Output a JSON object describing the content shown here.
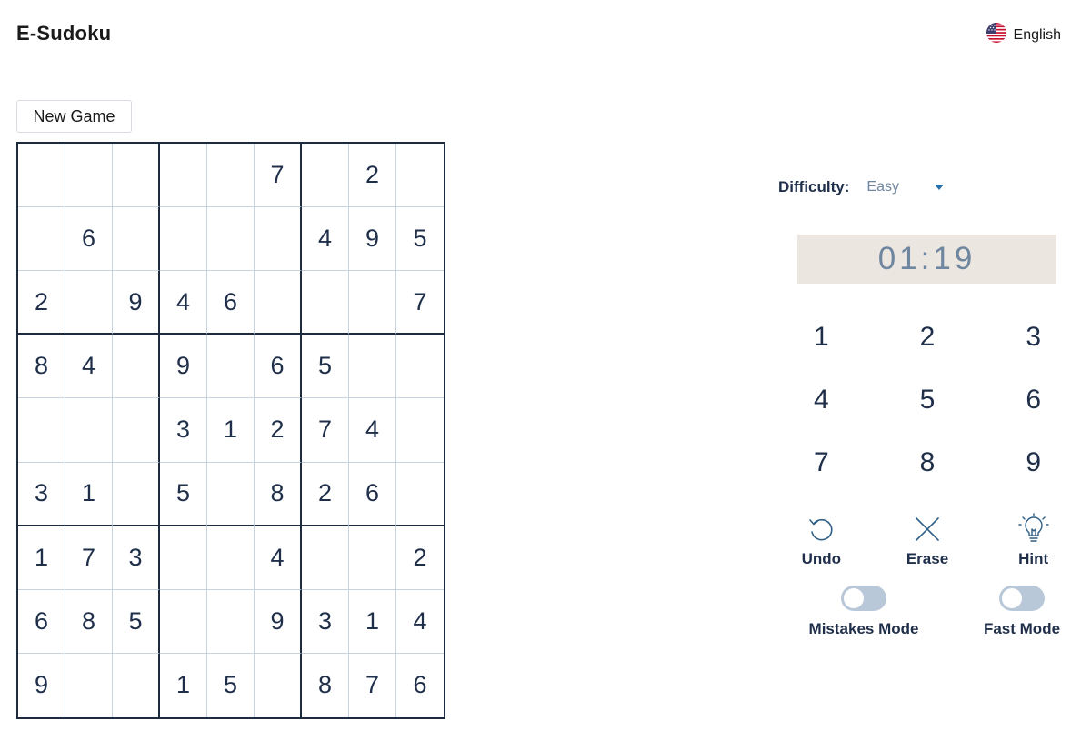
{
  "header": {
    "app_title": "E-Sudoku",
    "language": "English",
    "language_icon": "us-flag-icon"
  },
  "controls": {
    "new_game_label": "New Game"
  },
  "board": {
    "rows": [
      [
        "",
        "",
        "",
        "",
        "",
        "7",
        "",
        "2",
        ""
      ],
      [
        "",
        "6",
        "",
        "",
        "",
        "",
        "4",
        "9",
        "5"
      ],
      [
        "2",
        "",
        "9",
        "4",
        "6",
        "",
        "",
        "",
        "7"
      ],
      [
        "8",
        "4",
        "",
        "9",
        "",
        "6",
        "5",
        "",
        ""
      ],
      [
        "",
        "",
        "",
        "3",
        "1",
        "2",
        "7",
        "4",
        ""
      ],
      [
        "3",
        "1",
        "",
        "5",
        "",
        "8",
        "2",
        "6",
        ""
      ],
      [
        "1",
        "7",
        "3",
        "",
        "",
        "4",
        "",
        "",
        "2"
      ],
      [
        "6",
        "8",
        "5",
        "",
        "",
        "9",
        "3",
        "1",
        "4"
      ],
      [
        "9",
        "",
        "",
        "1",
        "5",
        "",
        "8",
        "7",
        "6"
      ]
    ]
  },
  "sidebar": {
    "difficulty_label": "Difficulty:",
    "difficulty_value": "Easy",
    "timer": "01:19",
    "numpad": [
      "1",
      "2",
      "3",
      "4",
      "5",
      "6",
      "7",
      "8",
      "9"
    ],
    "tools": [
      {
        "label": "Undo",
        "icon": "undo-icon"
      },
      {
        "label": "Erase",
        "icon": "erase-icon"
      },
      {
        "label": "Hint",
        "icon": "lightbulb-icon"
      }
    ],
    "modes": [
      {
        "label": "Mistakes Mode",
        "enabled": false
      },
      {
        "label": "Fast Mode",
        "enabled": false
      }
    ]
  },
  "colors": {
    "text_primary": "#1f2f4a",
    "grid_thin": "#c7d3df",
    "grid_thick": "#1e2b3f",
    "muted": "#6f86a0",
    "timer_bg": "#ece6e0",
    "toggle_off": "#b9c8d9",
    "caret": "#2a6fa8"
  }
}
